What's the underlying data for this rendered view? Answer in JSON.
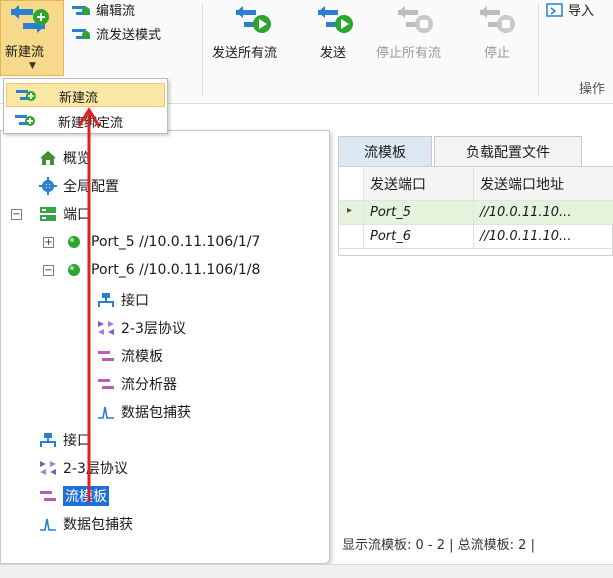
{
  "ribbon": {
    "new_flow": "新建流",
    "edit_flow": "编辑流",
    "flow_send_mode": "流发送模式",
    "send_all": "发送所有流",
    "send": "发送",
    "stop_all": "停止所有流",
    "stop": "停止",
    "import": "导入",
    "group_label": "操作"
  },
  "dropdown": {
    "items": [
      {
        "label": "新建流",
        "highlighted": true
      },
      {
        "label": "新建绑定流",
        "highlighted": false
      }
    ]
  },
  "tree": {
    "overview": "概览",
    "global_config": "全局配置",
    "ports": "端口",
    "port5": "Port_5 //10.0.11.106/1/7",
    "port6": "Port_6 //10.0.11.106/1/8",
    "p6_interface": "接口",
    "p6_protocol": "2-3层协议",
    "p6_template": "流模板",
    "p6_analyzer": "流分析器",
    "p6_capture": "数据包捕获",
    "interface": "接口",
    "protocol": "2-3层协议",
    "template": "流模板",
    "capture": "数据包捕获"
  },
  "tabs": {
    "flow_template": "流模板",
    "load_config": "负载配置文件"
  },
  "grid": {
    "headers": [
      "发送端口",
      "发送端口地址"
    ],
    "rows": [
      {
        "port": "Port_5",
        "address": "//10.0.11.10..."
      },
      {
        "port": "Port_6",
        "address": "//10.0.11.10..."
      }
    ],
    "row_marker": "▸"
  },
  "status": "显示流模板: 0 - 2 | 总流模板: 2 |",
  "colors": {
    "accent": "#1f6fd6",
    "highlight": "#fbe8a6",
    "annotation": "#e02020",
    "port_status": "#2ea52e"
  }
}
